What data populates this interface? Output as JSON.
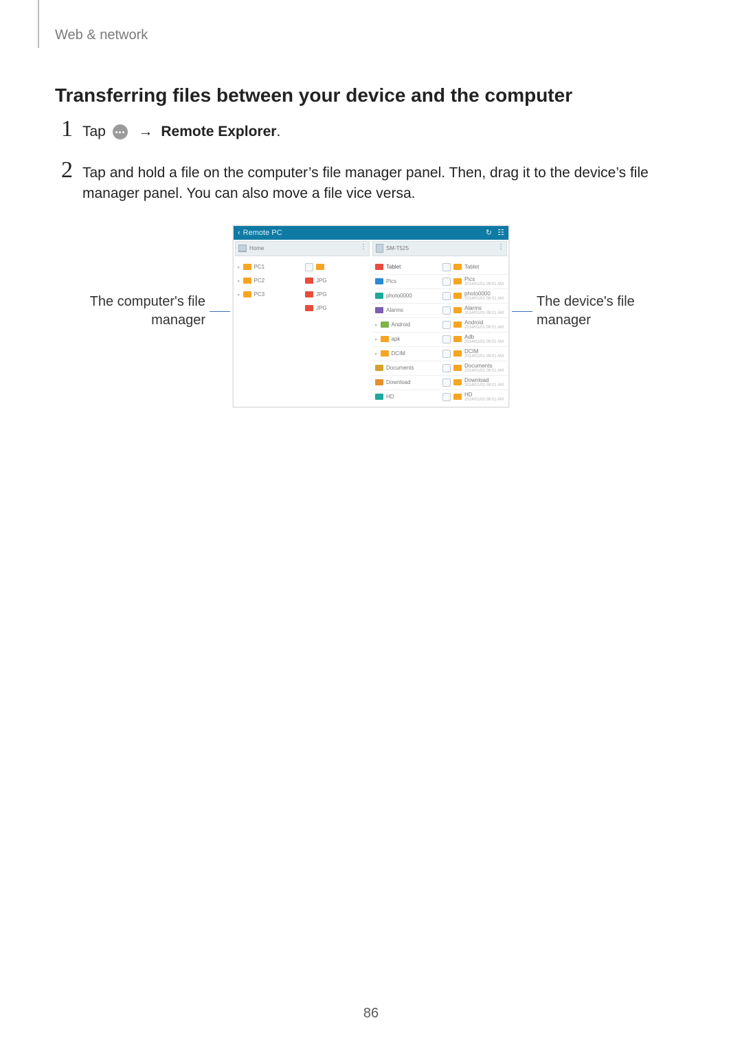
{
  "breadcrumb": "Web & network",
  "section_title": "Transferring files between your device and the computer",
  "steps": {
    "s1": {
      "num": "1",
      "pre": "Tap ",
      "arrow": "→",
      "target": "Remote Explorer",
      "post": "."
    },
    "s2": {
      "num": "2",
      "text": "Tap and hold a file on the computer’s file manager panel. Then, drag it to the device’s file manager panel. You can also move a file vice versa."
    }
  },
  "callouts": {
    "left": "The computer's file manager",
    "right": "The device's file manager"
  },
  "mock": {
    "header_title": "Remote PC",
    "left_pane_label": "Home",
    "right_pane_label": "SM-T525",
    "left_rows": [
      "PC1",
      "PC2",
      "PC3"
    ],
    "left_col2": [
      "",
      "JPG",
      "JPG",
      "JPG"
    ],
    "right_col1": [
      "Tablet",
      "Pics",
      "photo0000",
      "Alarms",
      "Android",
      "apk",
      "DCIM",
      "Documents",
      "Download",
      "HD"
    ],
    "right_col2_titles": [
      "Tablet",
      "Pics",
      "photo0000",
      "Alarms",
      "Android",
      "Adb",
      "DCIM",
      "Documents",
      "Download",
      "HD"
    ],
    "right_col2_subs": [
      "",
      "2014/01/01 09:01 AM",
      "2014/01/01 09:01 AM",
      "2014/01/01 09:01 AM",
      "2014/01/01 09:01 AM",
      "2014/01/01 09:01 AM",
      "2014/01/01 09:01 AM",
      "2014/01/01 09:01 AM",
      "2014/01/01 09:01 AM",
      "2014/01/01 09:01 AM"
    ]
  },
  "page_number": "86"
}
